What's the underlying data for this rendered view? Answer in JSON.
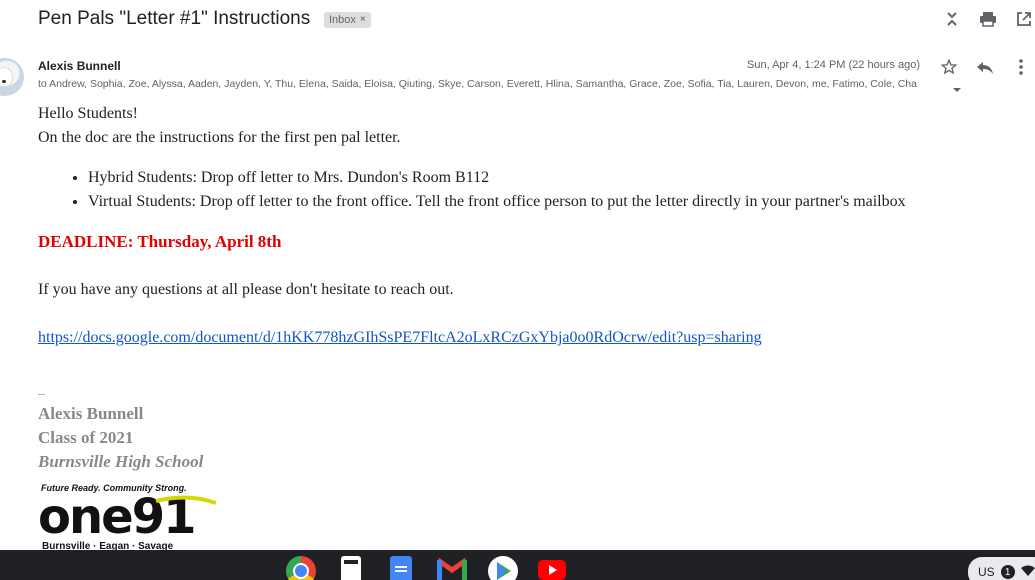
{
  "email": {
    "subject": "Pen Pals \"Letter #1\" Instructions",
    "label_chip": "Inbox",
    "label_chip_close": "×",
    "sender": "Alexis Bunnell",
    "timestamp": "Sun, Apr 4, 1:24 PM (22 hours ago)",
    "recipients": "to Andrew, Sophia, Zoe, Alyssa, Aaden, Jayden, Y, Thu, Elena, Saida, Eloisa, Qiuting, Skye, Carson, Everett, Hlina, Samantha, Grace, Zoe, Sofia, Tia, Lauren, Devon, me, Fatimo, Cole, Cha"
  },
  "body": {
    "greeting": "Hello Students!",
    "intro": "On the doc are the instructions for the first pen pal letter.",
    "bullets": [
      "Hybrid Students: Drop off letter to Mrs. Dundon's Room B112",
      "Virtual Students: Drop off letter to the front office. Tell the front office person to put the letter directly in your partner's mailbox"
    ],
    "deadline": "DEADLINE: Thursday, April 8th",
    "questions": "If you have any questions at all please don't hesitate to reach out.",
    "link": "https://docs.google.com/document/d/1hKK778hzGIhSsPE7FltcA2oLxRCzGxYbja0o0RdOcrw/edit?usp=sharing"
  },
  "signature": {
    "dash": "--",
    "name": "Alexis Bunnell",
    "class": "Class of 2021",
    "school": "Burnsville High School"
  },
  "logo": {
    "tagline": "Future Ready. Community Strong.",
    "main": "one91",
    "cities": "Burnsville · Eagan · Savage"
  },
  "icons": {
    "collapse": "collapse-icon",
    "print": "print-icon",
    "open_new_window": "open-in-new-window-icon",
    "star": "star-icon",
    "reply": "reply-icon",
    "more": "more-vert-icon"
  },
  "shelf": {
    "apps": [
      "chrome-icon",
      "calculator-icon",
      "docs-icon",
      "gmail-icon",
      "play-store-icon",
      "youtube-icon"
    ],
    "tray_locale": "US",
    "tray_badge": "1"
  },
  "colors": {
    "deadline": "#e00000",
    "link": "#1155cc",
    "signature": "#888888",
    "shelf": "#202124"
  }
}
